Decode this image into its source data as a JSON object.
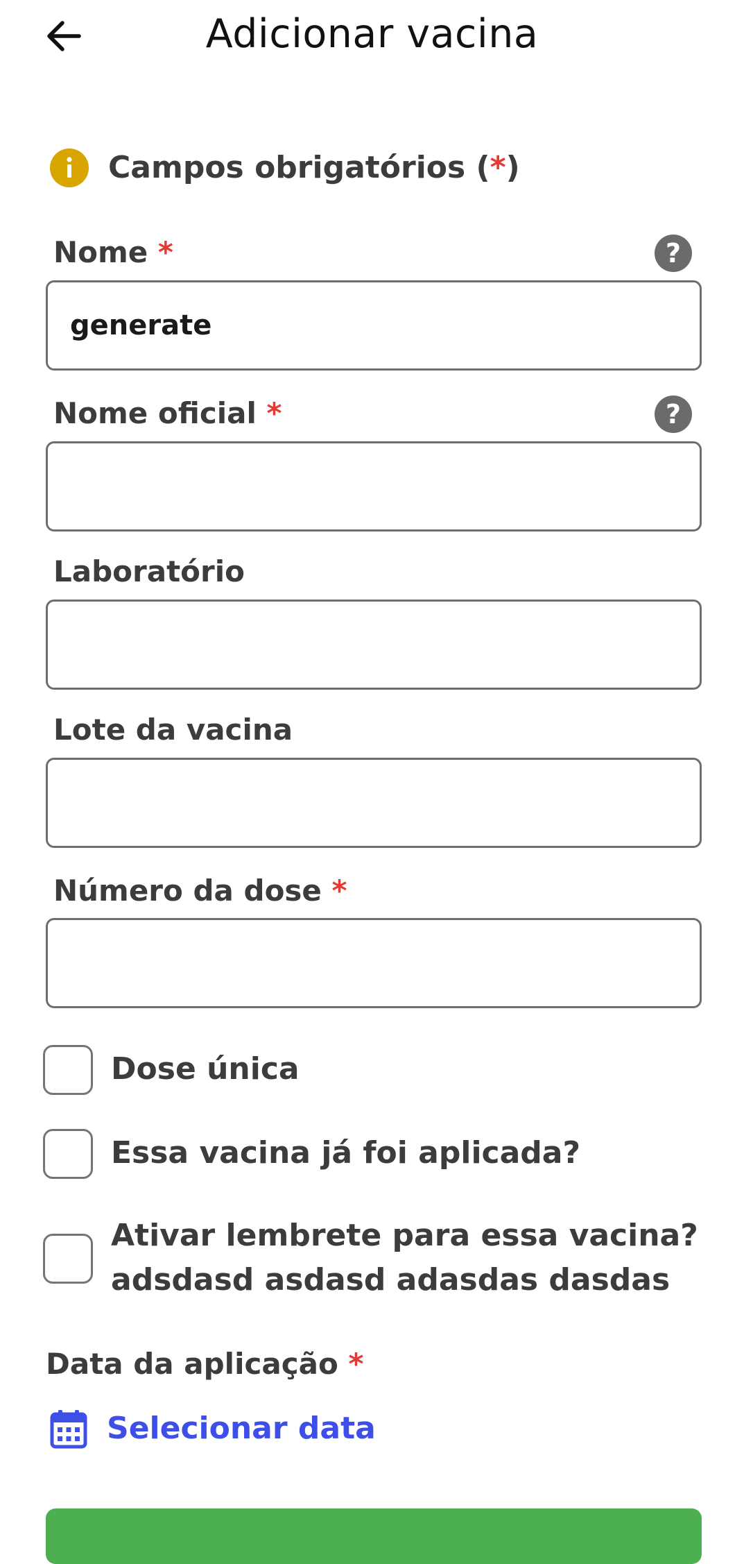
{
  "header": {
    "title": "Adicionar vacina",
    "back_icon": "arrow-left-icon"
  },
  "notice": {
    "text_prefix": "Campos obrigatórios (",
    "asterisk": "*",
    "text_suffix": ")",
    "icon": "info-icon"
  },
  "form": {
    "required_mark": "*",
    "nome": {
      "label": "Nome ",
      "value": "generate",
      "placeholder": ""
    },
    "nome_oficial": {
      "label": "Nome oficial ",
      "value": "",
      "placeholder": ""
    },
    "laboratorio": {
      "label": "Laboratório",
      "value": "",
      "placeholder": ""
    },
    "lote": {
      "label": "Lote da vacina",
      "value": "",
      "placeholder": ""
    },
    "numero_dose": {
      "label": "Número da dose ",
      "value": "",
      "placeholder": ""
    },
    "checkboxes": {
      "dose_unica": {
        "label": "Dose única",
        "checked": false
      },
      "ja_aplicada": {
        "label": "Essa vacina já foi aplicada?",
        "checked": false
      },
      "lembrete": {
        "line1": "Ativar lembrete para essa vacina?",
        "line2": "adsdasd asdasd adasdas dasdas",
        "checked": false
      }
    },
    "data_aplicacao": {
      "label": "Data da aplicação ",
      "link": "Selecionar data",
      "icon": "calendar-icon"
    }
  },
  "colors": {
    "accent_link": "#3d4fe6",
    "required": "#e53935",
    "info": "#d8a400",
    "submit": "#4caf50"
  }
}
